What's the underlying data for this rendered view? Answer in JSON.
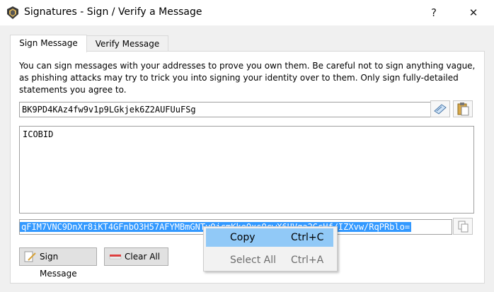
{
  "window": {
    "title": "Signatures - Sign / Verify a Message",
    "help_label": "?",
    "close_label": "✕"
  },
  "tabs": [
    {
      "label": "Sign Message",
      "active": true
    },
    {
      "label": "Verify Message",
      "active": false
    }
  ],
  "sign": {
    "description": "You can sign messages with your addresses to prove you own them. Be careful not to sign anything vague, as phishing attacks may try to trick you into signing your identity over to them. Only sign fully-detailed statements you agree to.",
    "address_value": "BK9PD4KAz4fw9v1p9LGkjek6Z2AUFUuFSg",
    "message_value": "ICOBID",
    "signature_value": "qFIM7VNC9DnXr8iKT4GFnbO3H57AFYMBmGNTvOjcmKkeOxsQcwX6UVga2GcHf/IZXvw/RqPRblo=",
    "sign_button_label": "Sign Message",
    "clear_button_label": "Clear All"
  },
  "context_menu": {
    "items": [
      {
        "label": "Copy",
        "shortcut": "Ctrl+C",
        "highlighted": true,
        "enabled": true
      },
      {
        "label": "Select All",
        "shortcut": "Ctrl+A",
        "highlighted": false,
        "enabled": false
      }
    ]
  },
  "colors": {
    "selection": "#3399ff",
    "menu_highlight": "#91c9f7"
  },
  "icons": {
    "app": "app-shield-icon",
    "address_book": "address-book-icon",
    "paste": "paste-clipboard-icon",
    "copy": "copy-icon",
    "sign": "sign-pen-icon",
    "clear": "eraser-icon"
  }
}
